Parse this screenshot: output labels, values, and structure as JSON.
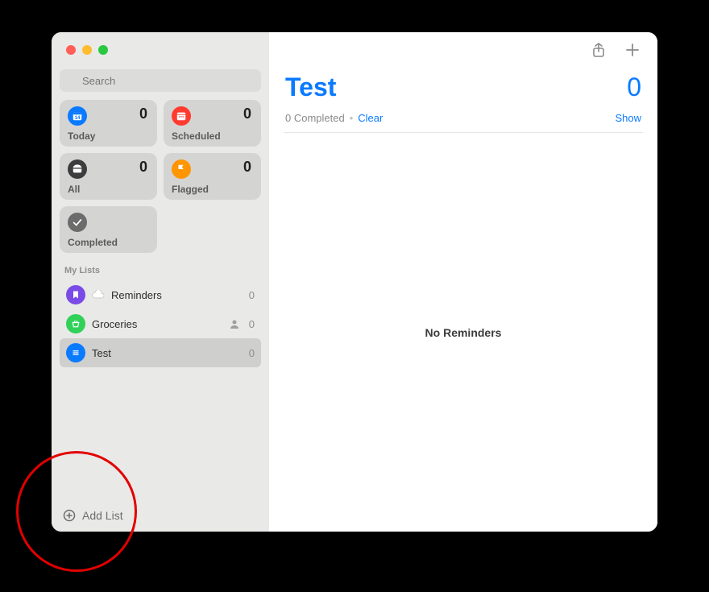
{
  "search": {
    "placeholder": "Search"
  },
  "smart": {
    "today": {
      "label": "Today",
      "count": "0"
    },
    "scheduled": {
      "label": "Scheduled",
      "count": "0"
    },
    "all": {
      "label": "All",
      "count": "0"
    },
    "flagged": {
      "label": "Flagged",
      "count": "0"
    },
    "completed": {
      "label": "Completed"
    }
  },
  "sidebar": {
    "section": "My Lists",
    "lists": [
      {
        "name": "Reminders",
        "count": "0"
      },
      {
        "name": "Groceries",
        "count": "0"
      },
      {
        "name": "Test",
        "count": "0"
      }
    ],
    "add_label": "Add List"
  },
  "main": {
    "title": "Test",
    "count": "0",
    "completed_text": "0 Completed",
    "clear": "Clear",
    "show": "Show",
    "empty": "No Reminders"
  }
}
